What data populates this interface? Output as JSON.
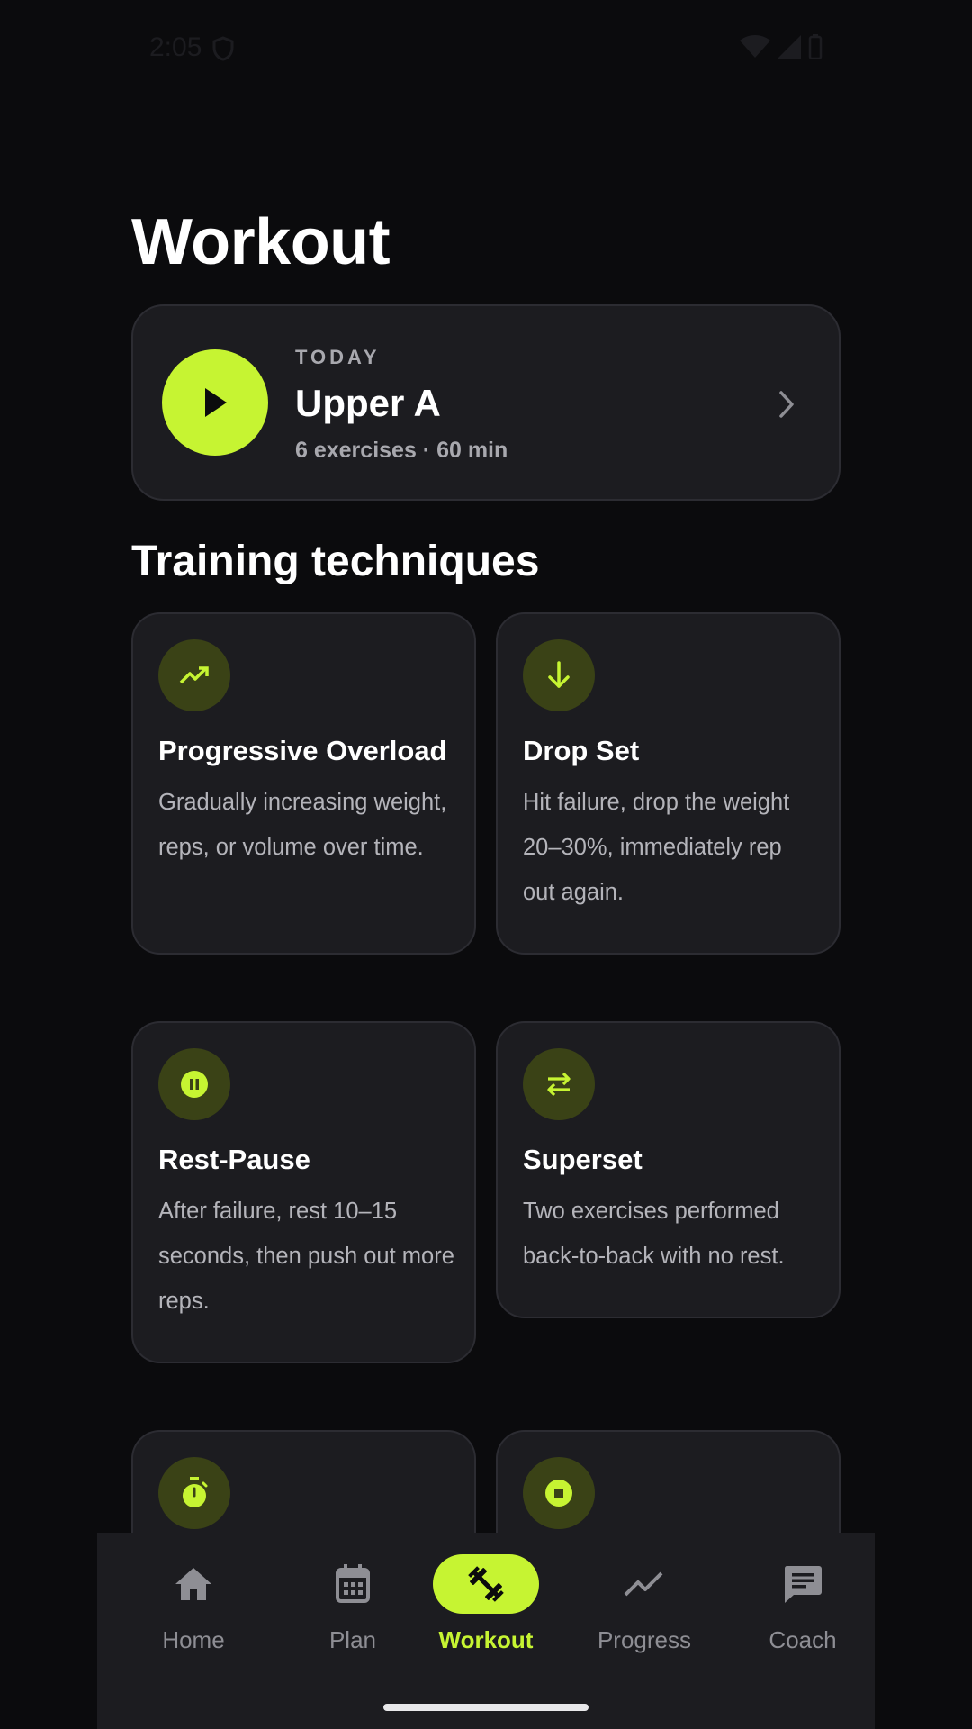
{
  "status_bar": {
    "time": "2:05"
  },
  "page": {
    "title": "Workout"
  },
  "today": {
    "label": "TODAY",
    "name": "Upper A",
    "meta": "6 exercises · 60 min"
  },
  "section": {
    "title": "Training techniques"
  },
  "techniques": [
    {
      "icon": "trending-up-icon",
      "title": "Progressive Overload",
      "description": "Gradually increasing weight, reps, or volume over time."
    },
    {
      "icon": "arrow-down-icon",
      "title": "Drop Set",
      "description": "Hit failure, drop the weight 20–30%, immediately rep out again."
    },
    {
      "icon": "pause-circle-icon",
      "title": "Rest-Pause",
      "description": "After failure, rest 10–15 seconds, then push out more reps."
    },
    {
      "icon": "swap-icon",
      "title": "Superset",
      "description": "Two exercises performed back-to-back with no rest."
    },
    {
      "icon": "stopwatch-icon",
      "title": "",
      "description": ""
    },
    {
      "icon": "stop-circle-icon",
      "title": "",
      "description": ""
    }
  ],
  "nav": {
    "items": [
      {
        "label": "Home",
        "icon": "home-icon"
      },
      {
        "label": "Plan",
        "icon": "calendar-icon"
      },
      {
        "label": "Workout",
        "icon": "dumbbell-icon",
        "active": true
      },
      {
        "label": "Progress",
        "icon": "trending-up-icon"
      },
      {
        "label": "Coach",
        "icon": "chat-icon"
      }
    ]
  },
  "colors": {
    "accent": "#c6f432",
    "background": "#0b0b0d",
    "card": "#1c1c20",
    "icon_bg": "#3a4216",
    "muted_text": "#a8a8ae"
  }
}
